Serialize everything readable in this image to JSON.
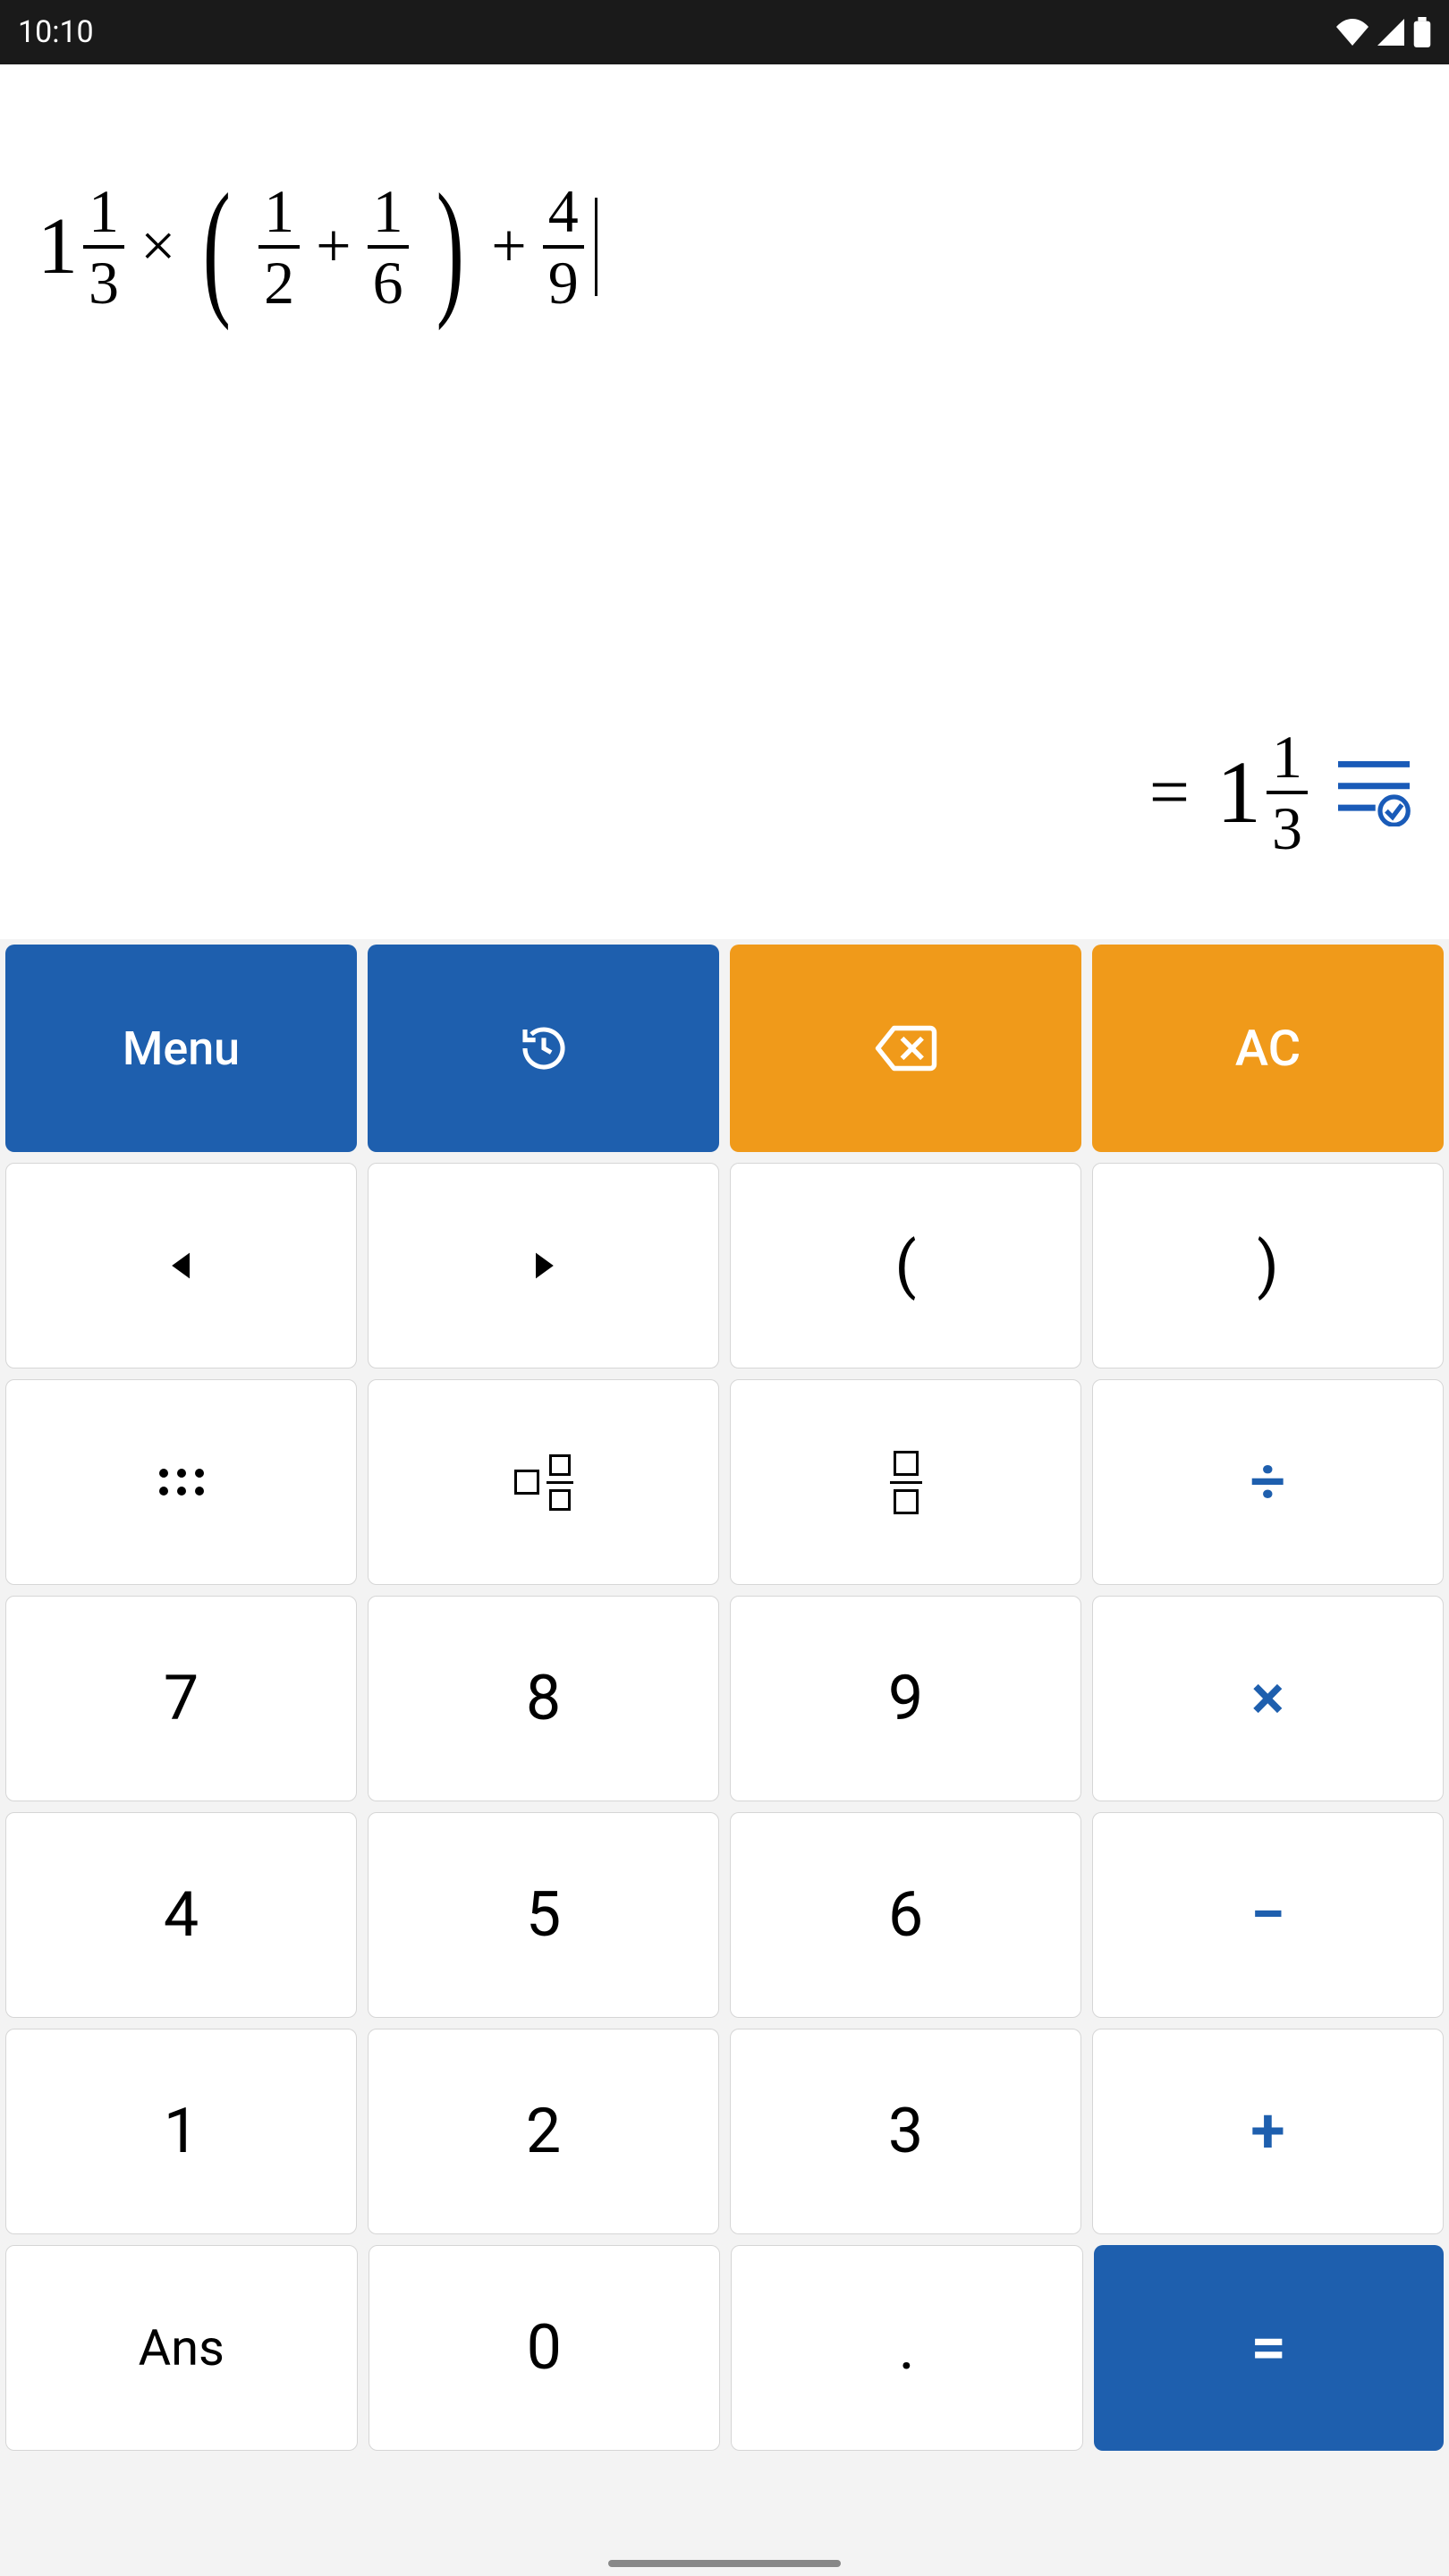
{
  "status": {
    "time": "10:10"
  },
  "expression": {
    "term1": {
      "whole": "1",
      "num": "1",
      "den": "3"
    },
    "op1": "×",
    "paren_open": "(",
    "term2": {
      "num": "1",
      "den": "2"
    },
    "op2": "+",
    "term3": {
      "num": "1",
      "den": "6"
    },
    "paren_close": ")",
    "op3": "+",
    "term4": {
      "num": "4",
      "den": "9"
    }
  },
  "result": {
    "eq": "=",
    "whole": "1",
    "num": "1",
    "den": "3"
  },
  "keys": {
    "menu": "Menu",
    "ac": "AC",
    "lparen": "(",
    "rparen": ")",
    "divide": "÷",
    "k7": "7",
    "k8": "8",
    "k9": "9",
    "multiply": "×",
    "k4": "4",
    "k5": "5",
    "k6": "6",
    "minus": "−",
    "k1": "1",
    "k2": "2",
    "k3": "3",
    "plus": "+",
    "ans": "Ans",
    "k0": "0",
    "dot": ".",
    "equals": "="
  }
}
